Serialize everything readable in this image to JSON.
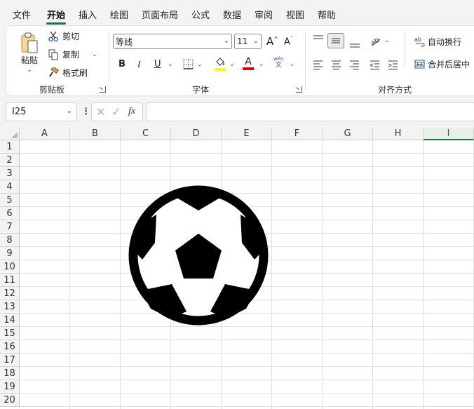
{
  "menu": {
    "tabs": [
      "文件",
      "开始",
      "插入",
      "绘图",
      "页面布局",
      "公式",
      "数据",
      "审阅",
      "视图",
      "帮助"
    ],
    "active_tab": "开始"
  },
  "ribbon": {
    "clipboard": {
      "paste_label": "粘贴",
      "cut_label": "剪切",
      "copy_label": "复制",
      "format_painter_label": "格式刷",
      "group_label": "剪贴板"
    },
    "font": {
      "font_name": "等线",
      "font_size": "11",
      "group_label": "字体",
      "phonetic_top": "wén",
      "phonetic_bottom": "文",
      "bold": "B",
      "italic": "I",
      "underline": "U",
      "font_color_letter": "A",
      "highlight_color": "#ffff00",
      "font_color": "#e00000"
    },
    "alignment": {
      "wrap_text_label": "自动换行",
      "merge_center_label": "合并后居中",
      "group_label": "对齐方式"
    }
  },
  "formula_bar": {
    "name_box": "I25",
    "formula": "",
    "fx_label": "fx"
  },
  "sheet": {
    "columns": [
      "A",
      "B",
      "C",
      "D",
      "E",
      "F",
      "G",
      "H",
      "I"
    ],
    "selected_column": "I",
    "rows": [
      "1",
      "2",
      "3",
      "4",
      "5",
      "6",
      "7",
      "8",
      "9",
      "10",
      "11",
      "12",
      "13",
      "14",
      "15",
      "16",
      "17",
      "18",
      "19",
      "20"
    ],
    "accent_color": "#217346",
    "shape": "soccer-ball-icon"
  }
}
